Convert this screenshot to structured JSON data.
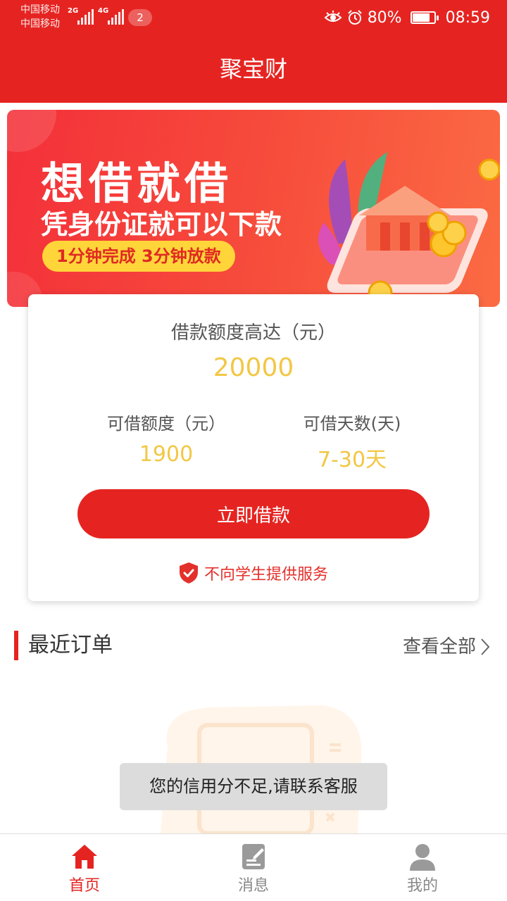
{
  "status_bar": {
    "carrier_1": "中国移动",
    "carrier_2": "中国移动",
    "net_1": "2G",
    "net_2": "4G",
    "notification_count": "2",
    "battery": "80%",
    "battery_level": 0.8,
    "time": "08:59",
    "icons": [
      "eye-icon",
      "alarm-icon",
      "battery-icon"
    ]
  },
  "header": {
    "title": "聚宝财"
  },
  "banner": {
    "headline": "想借就借",
    "subline": "凭身份证就可以下款",
    "pill": "1分钟完成 3分钟放款"
  },
  "loan_card": {
    "max_label": "借款额度高达（元）",
    "max_value": "20000",
    "available_label": "可借额度（元）",
    "available_value": "1900",
    "days_label": "可借天数(天)",
    "days_value": "7-30天",
    "cta": "立即借款",
    "notice": "不向学生提供服务"
  },
  "orders": {
    "title": "最近订单",
    "view_all": "查看全部"
  },
  "toast": "您的信用分不足,请联系客服",
  "tabs": [
    {
      "label": "首页",
      "icon": "home-icon",
      "active": true
    },
    {
      "label": "消息",
      "icon": "message-icon",
      "active": false
    },
    {
      "label": "我的",
      "icon": "user-icon",
      "active": false
    }
  ],
  "colors": {
    "primary": "#e52421",
    "amount": "#f2c744",
    "pill": "#ffd53a",
    "toast_bg": "#dcdcdc"
  }
}
